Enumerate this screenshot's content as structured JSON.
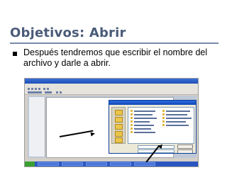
{
  "slide": {
    "title": "Objetivos: Abrir",
    "bullet": "Después tendremos que escribir el nombre del archivo y darle a abrir."
  },
  "colors": {
    "title": "#4a5b78",
    "rule": "#7a8aa8",
    "taskbar": "#2b56c0",
    "dialog_title": "#2f6be0"
  },
  "screenshot": {
    "description_icon": "word-open-dialog-screenshot"
  }
}
